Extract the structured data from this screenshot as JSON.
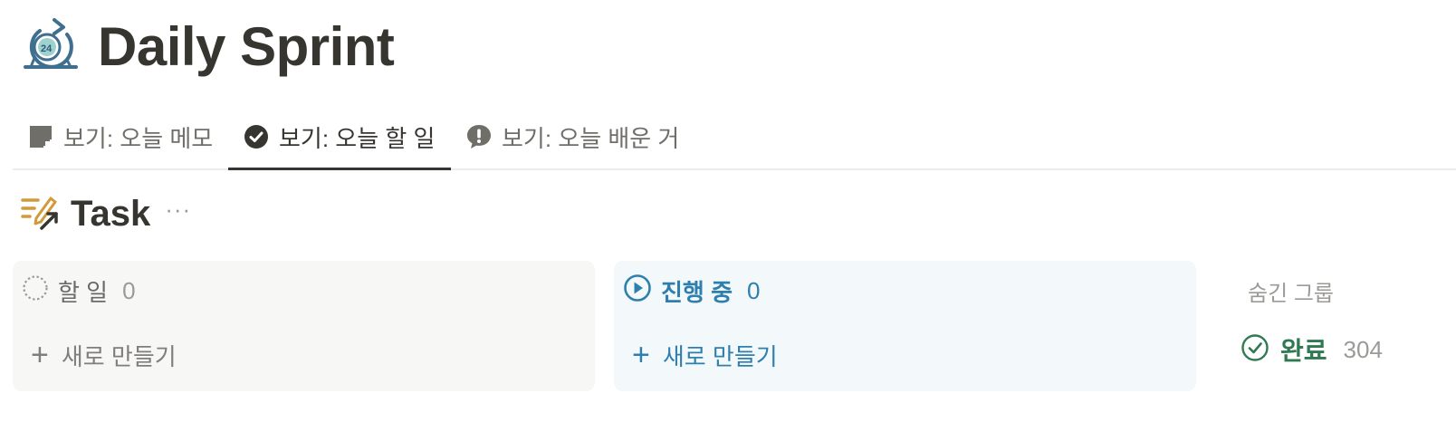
{
  "page": {
    "title": "Daily Sprint",
    "icon": "24-hour-cycle-icon"
  },
  "tabs": [
    {
      "label": "보기: 오늘 메모",
      "icon": "sticky-note-icon",
      "active": false
    },
    {
      "label": "보기: 오늘 할 일",
      "icon": "check-circle-icon",
      "active": true
    },
    {
      "label": "보기: 오늘 배운 거",
      "icon": "exclamation-bubble-icon",
      "active": false
    }
  ],
  "database": {
    "title": "Task",
    "icon": "task-list-pen-icon",
    "more": "···"
  },
  "board": {
    "columns": [
      {
        "label": "할 일",
        "count": "0",
        "icon": "dashed-circle-icon",
        "new_label": "새로 만들기",
        "color": "#6b6a66",
        "bg": "#f7f7f5"
      },
      {
        "label": "진행 중",
        "count": "0",
        "icon": "play-circle-icon",
        "new_label": "새로 만들기",
        "color": "#2f7fae",
        "bg": "#f3f8fb"
      }
    ],
    "hidden_label": "숨긴 그룹",
    "hidden_groups": [
      {
        "label": "완료",
        "count": "304",
        "icon": "check-circle-outline-icon",
        "color": "#2f7a52"
      }
    ]
  },
  "colors": {
    "text": "#37352f",
    "muted": "#9b9a97",
    "in_progress": "#2f7fae",
    "done": "#2f7a52",
    "db_icon": "#d29a3a"
  }
}
